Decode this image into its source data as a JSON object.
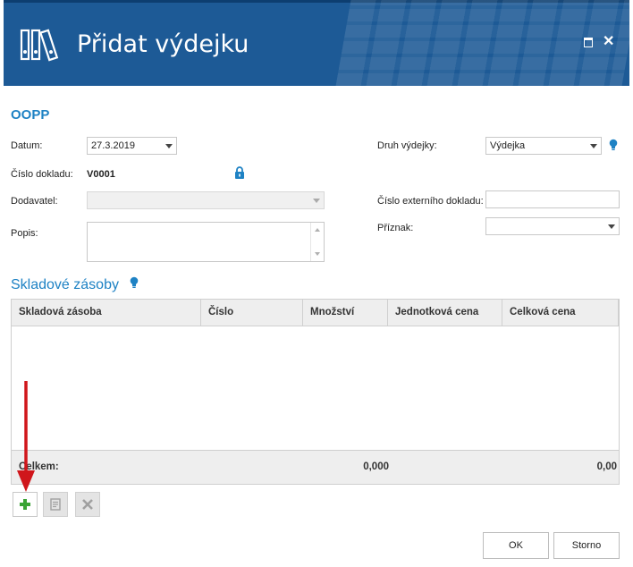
{
  "window": {
    "title": "Přidat výdejku",
    "controls": [
      "maximize",
      "close"
    ],
    "close_glyph": "✕"
  },
  "form": {
    "section_title": "OOPP",
    "datum_label": "Datum:",
    "datum_value": "27.3.2019",
    "cislo_dokladu_label": "Číslo dokladu:",
    "cislo_dokladu_value": "V0001",
    "dodavatel_label": "Dodavatel:",
    "dodavatel_value": "",
    "popis_label": "Popis:",
    "popis_value": "",
    "druh_vydejky_label": "Druh výdejky:",
    "druh_vydejky_value": "Výdejka",
    "cislo_externiho_label": "Číslo externího dokladu:",
    "cislo_externiho_value": "",
    "priznak_label": "Příznak:",
    "priznak_value": ""
  },
  "stock": {
    "section_title": "Skladové zásoby",
    "columns": [
      "Skladová zásoba",
      "Číslo",
      "Množství",
      "Jednotková cena",
      "Celková cena"
    ],
    "rows": [],
    "footer": {
      "label": "Celkem:",
      "mnozstvi_total": "0,000",
      "celkova_total": "0,00"
    }
  },
  "toolbar": {
    "add_icon": "plus-icon",
    "edit_icon": "document-icon",
    "delete_icon": "x-icon",
    "add_enabled": true,
    "edit_enabled": false,
    "delete_enabled": false
  },
  "buttons": {
    "ok_label": "OK",
    "cancel_label": "Storno"
  },
  "colors": {
    "header_bg": "#1d5a96",
    "accent": "#1e82c4",
    "add_green": "#3aa335",
    "annotation_arrow": "#d0161b"
  }
}
